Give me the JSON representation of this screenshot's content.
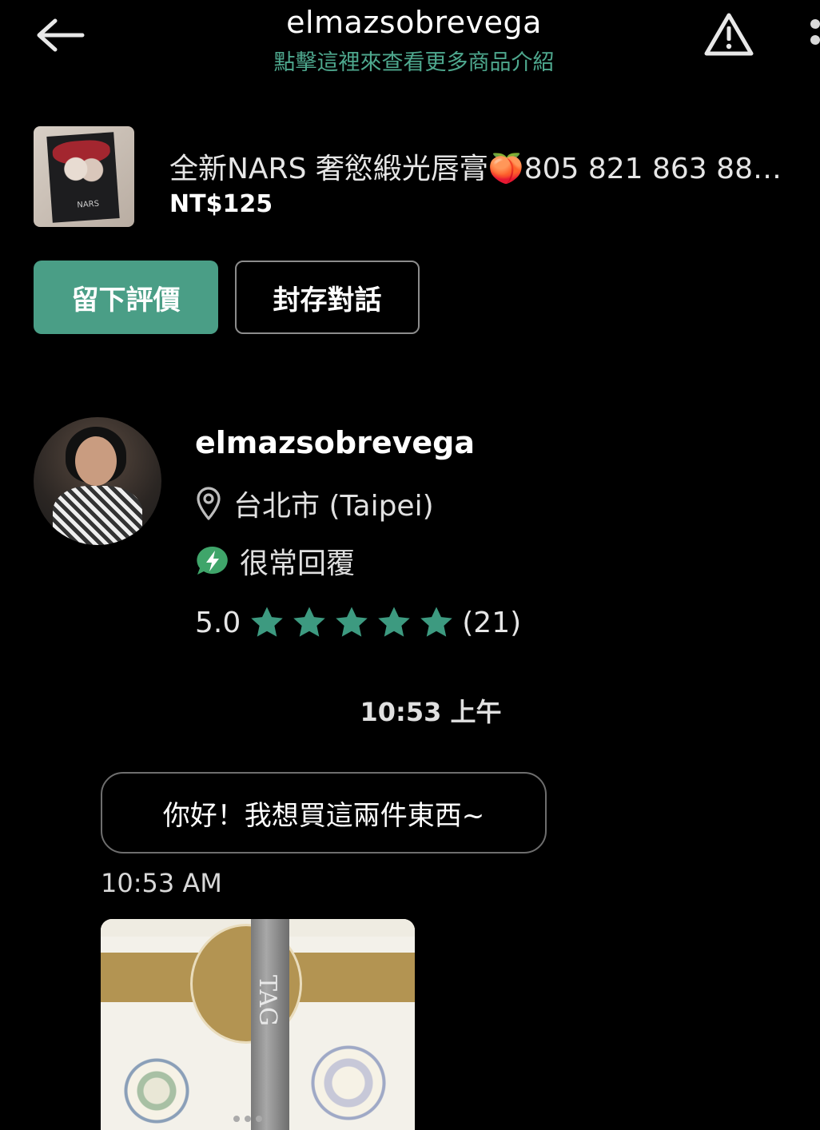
{
  "header": {
    "title": "elmazsobrevega",
    "subtitle": "點擊這裡來查看更多商品介紹",
    "back_icon": "arrow-left-icon",
    "warning_icon": "warning-triangle-icon",
    "more_icon": "more-vertical-icon"
  },
  "product": {
    "name": "全新NARS 奢慾緞光唇膏🍑805 821 863 88…",
    "price": "NT$125"
  },
  "actions": {
    "leave_review": "留下評價",
    "archive_chat": "封存對話"
  },
  "seller": {
    "name": "elmazsobrevega",
    "location": "台北市 (Taipei)",
    "response": "很常回覆",
    "rating": "5.0",
    "stars": 5,
    "review_count": "(21)"
  },
  "chat": {
    "date_divider": "10:53 上午",
    "message": "你好！我想買這兩件東西~",
    "message_time": "10:53 AM",
    "photo_pencil_text": "TAG"
  },
  "colors": {
    "accent": "#4a9e86",
    "link": "#4ea88e",
    "background": "#000000"
  }
}
